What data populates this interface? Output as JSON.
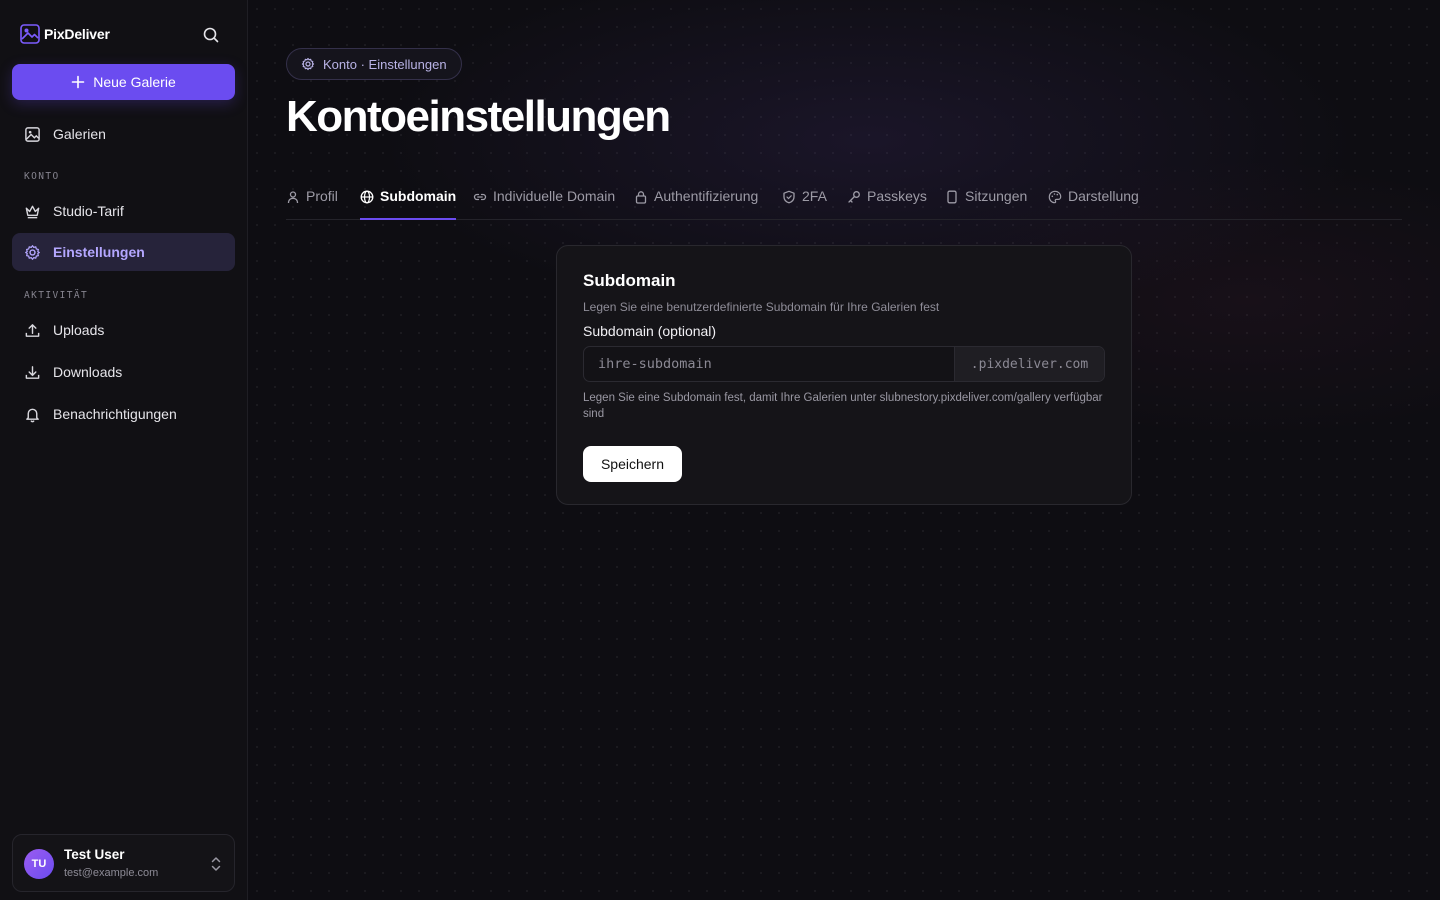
{
  "brand": {
    "name": "PixDeliver"
  },
  "sidebar": {
    "new_gallery_label": "Neue Galerie",
    "galleries_label": "Galerien",
    "section_account": "KONTO",
    "plan_label": "Studio-Tarif",
    "settings_label": "Einstellungen",
    "section_activity": "AKTIVITÄT",
    "uploads_label": "Uploads",
    "downloads_label": "Downloads",
    "notifications_label": "Benachrichtigungen"
  },
  "user": {
    "initials": "TU",
    "name": "Test User",
    "email": "test@example.com"
  },
  "breadcrumb": {
    "text": "Konto · Einstellungen"
  },
  "page": {
    "title": "Kontoeinstellungen"
  },
  "tabs": [
    {
      "label": "Profil",
      "icon": "user-icon"
    },
    {
      "label": "Subdomain",
      "icon": "globe-icon",
      "active": true
    },
    {
      "label": "Individuelle Domain",
      "icon": "link-icon"
    },
    {
      "label": "Authentifizierung",
      "icon": "lock-icon"
    },
    {
      "label": "2FA",
      "icon": "shield-icon"
    },
    {
      "label": "Passkeys",
      "icon": "key-icon"
    },
    {
      "label": "Sitzungen",
      "icon": "device-icon"
    },
    {
      "label": "Darstellung",
      "icon": "palette-icon"
    }
  ],
  "card": {
    "title": "Subdomain",
    "description": "Legen Sie eine benutzerdefinierte Subdomain für Ihre Galerien fest",
    "field_label": "Subdomain (optional)",
    "input_value": "",
    "input_placeholder": "ihre-subdomain",
    "suffix": ".pixdeliver.com",
    "hint": "Legen Sie eine Subdomain fest, damit Ihre Galerien unter slubnestory.pixdeliver.com/gallery verfügbar sind",
    "save_label": "Speichern"
  },
  "colors": {
    "accent": "#6b4cf0",
    "active_bg": "#26233a",
    "active_text": "#b4a7ff"
  }
}
